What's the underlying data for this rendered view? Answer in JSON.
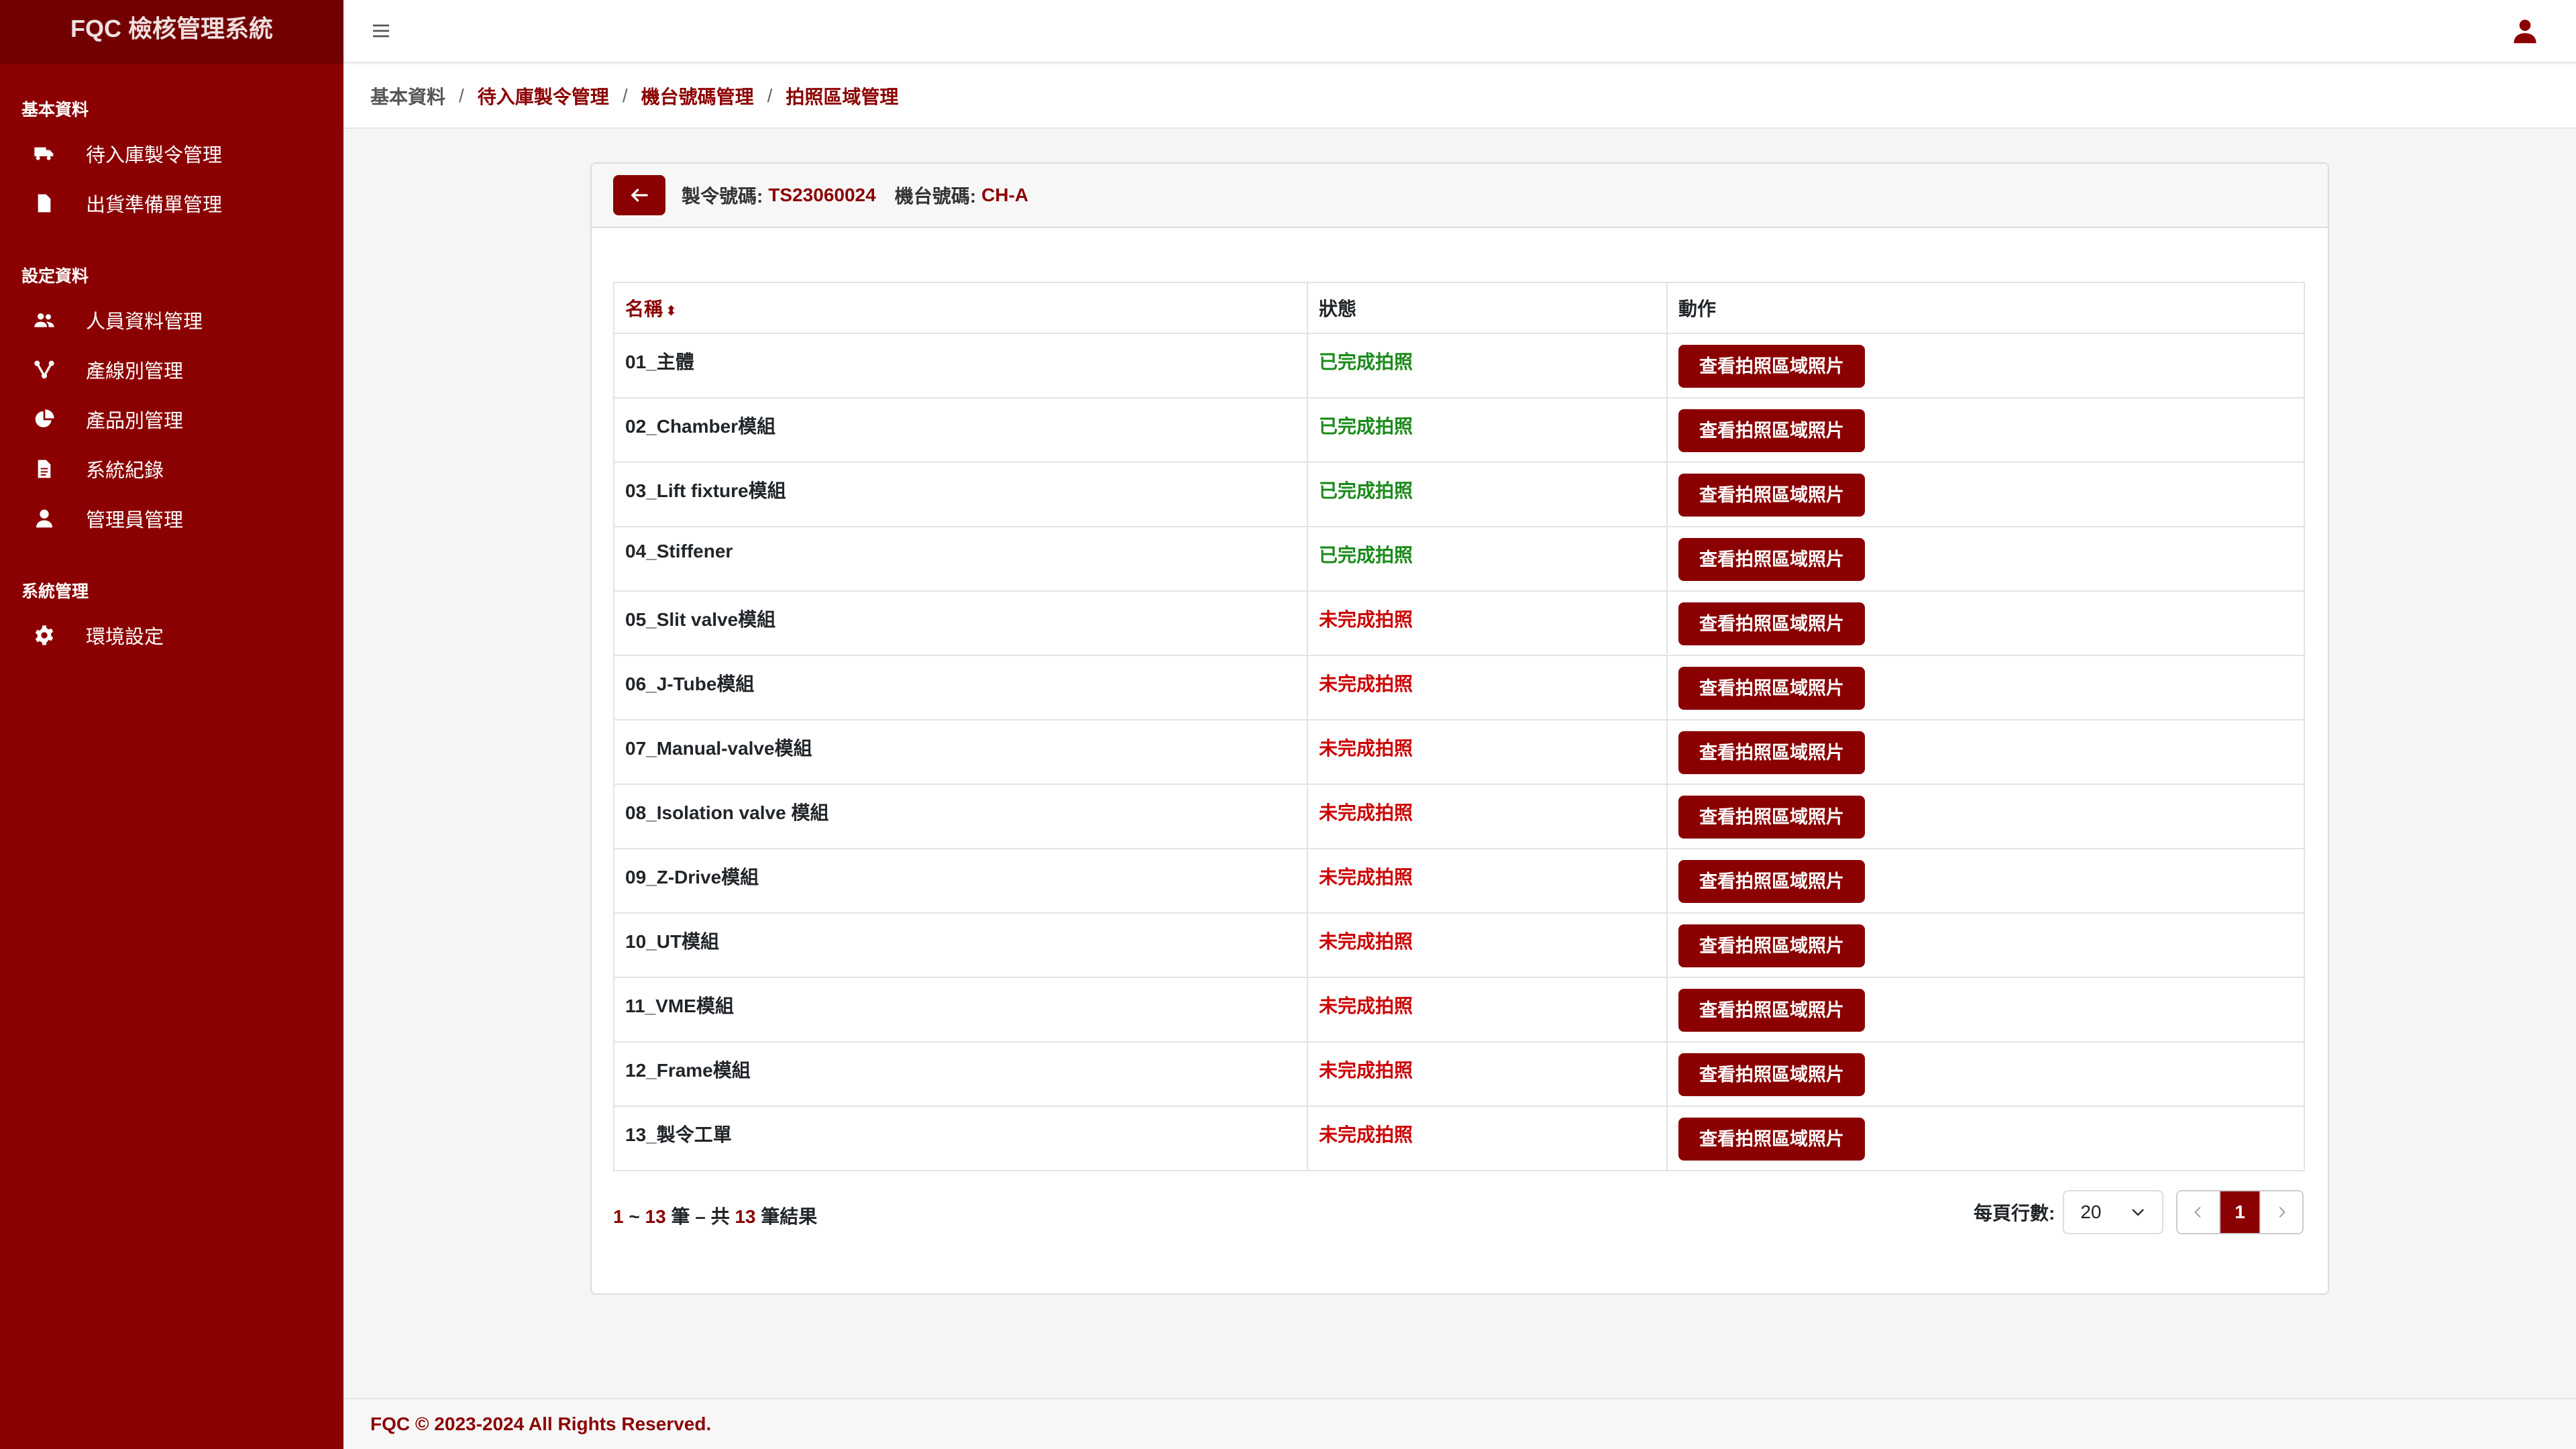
{
  "app": {
    "title": "FQC 檢核管理系統"
  },
  "sidebar": {
    "sections": [
      {
        "title": "基本資料",
        "items": [
          {
            "label": "待入庫製令管理",
            "icon": "truck-icon"
          },
          {
            "label": "出貨準備單管理",
            "icon": "file-icon"
          }
        ]
      },
      {
        "title": "設定資料",
        "items": [
          {
            "label": "人員資料管理",
            "icon": "users-icon"
          },
          {
            "label": "產線別管理",
            "icon": "network-icon"
          },
          {
            "label": "產品別管理",
            "icon": "pie-chart-icon"
          },
          {
            "label": "系統紀錄",
            "icon": "document-icon"
          },
          {
            "label": "管理員管理",
            "icon": "user-icon"
          }
        ]
      },
      {
        "title": "系統管理",
        "items": [
          {
            "label": "環境設定",
            "icon": "gear-icon"
          }
        ]
      }
    ]
  },
  "breadcrumb": [
    "基本資料",
    "待入庫製令管理",
    "機台號碼管理",
    "拍照區域管理"
  ],
  "header": {
    "order_label": "製令號碼:",
    "order_value": "TS23060024",
    "machine_label": "機台號碼:",
    "machine_value": "CH-A"
  },
  "table": {
    "columns": [
      "名稱",
      "狀態",
      "動作"
    ],
    "action_label": "查看拍照區域照片",
    "rows": [
      {
        "name": "01_主體",
        "status": "已完成拍照",
        "done": true
      },
      {
        "name": "02_Chamber模組",
        "status": "已完成拍照",
        "done": true
      },
      {
        "name": "03_Lift fixture模組",
        "status": "已完成拍照",
        "done": true
      },
      {
        "name": "04_Stiffener",
        "status": "已完成拍照",
        "done": true
      },
      {
        "name": "05_Slit valve模組",
        "status": "未完成拍照",
        "done": false
      },
      {
        "name": "06_J-Tube模組",
        "status": "未完成拍照",
        "done": false
      },
      {
        "name": "07_Manual-valve模組",
        "status": "未完成拍照",
        "done": false
      },
      {
        "name": "08_Isolation valve 模組",
        "status": "未完成拍照",
        "done": false
      },
      {
        "name": "09_Z-Drive模組",
        "status": "未完成拍照",
        "done": false
      },
      {
        "name": "10_UT模組",
        "status": "未完成拍照",
        "done": false
      },
      {
        "name": "11_VME模組",
        "status": "未完成拍照",
        "done": false
      },
      {
        "name": "12_Frame模組",
        "status": "未完成拍照",
        "done": false
      },
      {
        "name": "13_製令工單",
        "status": "未完成拍照",
        "done": false
      }
    ]
  },
  "pagination": {
    "range_start": "1",
    "range_sep": " ~ ",
    "range_end": "13",
    "mid_text": " 筆 – 共 ",
    "total": "13",
    "end_text": " 筆結果",
    "per_page_label": "每頁行數:",
    "per_page_value": "20",
    "current_page": "1"
  },
  "footer": {
    "text": "FQC © 2023-2024 All Rights Reserved."
  },
  "colors": {
    "brand": "#8b0000",
    "done": "#1a8a1a",
    "pending": "#cc0000"
  }
}
